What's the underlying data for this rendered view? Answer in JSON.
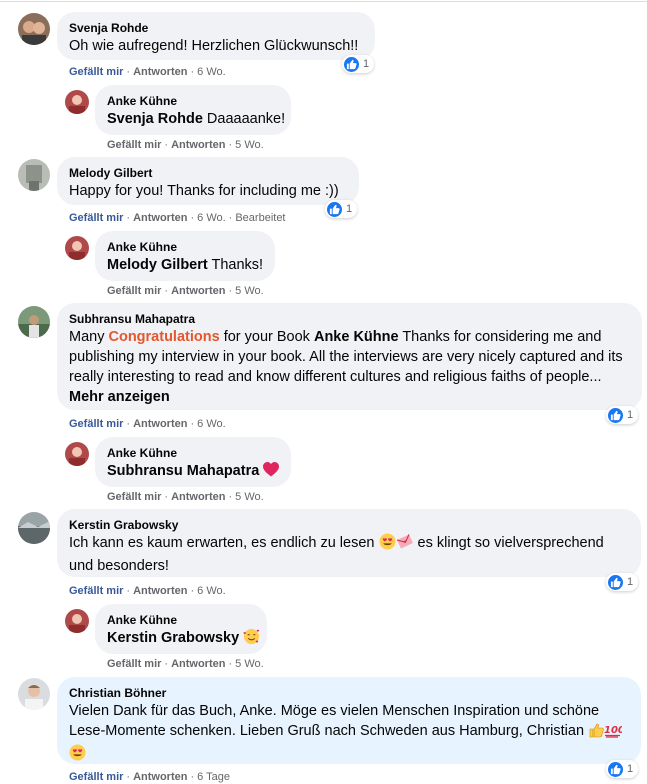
{
  "colors": {
    "bubble": "#f0f2f5",
    "bubble_highlight": "#e7f3ff",
    "link_blue": "#385898",
    "meta_gray": "#65676b",
    "like_blue": "#1877f2",
    "congrats_orange": "#e4572e"
  },
  "actions": {
    "like": "Gefällt mir",
    "reply": "Antworten",
    "edited": "Bearbeitet"
  },
  "comments": [
    {
      "author": "Svenja Rohde",
      "text": "Oh wie aufregend! Herzlichen Glückwunsch!!",
      "time": "6 Wo.",
      "reactions": "1",
      "reply": {
        "author": "Anke Kühne",
        "tag": "Svenja Rohde",
        "text": " Daaaaanke!",
        "time": "5 Wo."
      }
    },
    {
      "author": "Melody Gilbert",
      "text": "Happy for you! Thanks for including me :))",
      "time": "6 Wo.",
      "reactions": "1",
      "reply": {
        "author": "Anke Kühne",
        "tag": "Melody Gilbert",
        "text": " Thanks!",
        "time": "5 Wo."
      }
    },
    {
      "author": "Subhransu Mahapatra",
      "text_pre": "Many ",
      "text_highlight": "Congratulations",
      "text_mid": " for your Book ",
      "text_tag": "Anke Kühne",
      "text_post": " Thanks for considering me and publishing my interview in your book. All the interviews are very nicely captured and its really interesting to read and know different cultures and religious faiths of people... ",
      "more": "Mehr anzeigen",
      "time": "6 Wo.",
      "reactions": "1",
      "reply": {
        "author": "Anke Kühne",
        "tag": "Subhransu Mahapatra",
        "emoji": "red-heart",
        "time": "5 Wo."
      }
    },
    {
      "author": "Kerstin Grabowsky",
      "text_a": "Ich kann es kaum erwarten, es endlich zu lesen ",
      "text_b": " es klingt so vielversprechend und besonders!",
      "emojis": [
        "heart-eyes-emoji",
        "love-letter-emoji"
      ],
      "time": "6 Wo.",
      "reactions": "1",
      "reply": {
        "author": "Anke Kühne",
        "tag": "Kerstin Grabowsky",
        "emoji": "smiling-face-with-hearts",
        "time": "5 Wo."
      }
    },
    {
      "author": "Christian Böhner",
      "text": "Vielen Dank für das Buch, Anke. Möge es vielen Menschen Inspiration und schöne Lese-Momente schenken. Lieben Gruß nach Schweden aus Hamburg, Christian ",
      "emojis": [
        "thumbs-up-emoji",
        "hundred-points-emoji",
        "heart-eyes-emoji"
      ],
      "time": "6 Tage",
      "reactions": "1"
    }
  ]
}
